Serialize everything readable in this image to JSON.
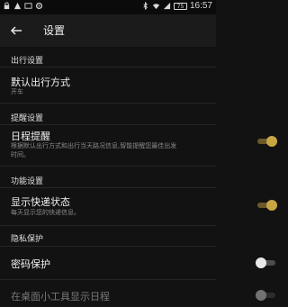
{
  "status_bar": {
    "battery": "75",
    "time": "16:57",
    "left_icons": [
      "lock-icon",
      "warning-icon",
      "message-icon",
      "settings-icon"
    ],
    "right_icons": [
      "bluetooth-icon",
      "wifi-icon",
      "signal-icon"
    ]
  },
  "app_bar": {
    "title": "设置"
  },
  "sections": {
    "travel": {
      "header": "出行设置"
    },
    "reminder": {
      "header": "提醒设置"
    },
    "feature": {
      "header": "功能设置"
    },
    "privacy": {
      "header": "隐私保护"
    }
  },
  "items": {
    "default_travel": {
      "title": "默认出行方式",
      "subtitle": "开车"
    },
    "schedule_reminder": {
      "title": "日程提醒",
      "subtitle": "根据默认出行方式和出行当天路况信息,智能提醒您最佳出发时间。",
      "enabled": true
    },
    "show_express": {
      "title": "显示快递状态",
      "subtitle": "每天显示您的快递信息。",
      "enabled": true
    },
    "password": {
      "title": "密码保护",
      "enabled": false
    },
    "widget_schedule": {
      "title": "在桌面小工具显示日程",
      "enabled": false
    }
  },
  "colors": {
    "accent": "#c9a645",
    "background": "#121212"
  }
}
